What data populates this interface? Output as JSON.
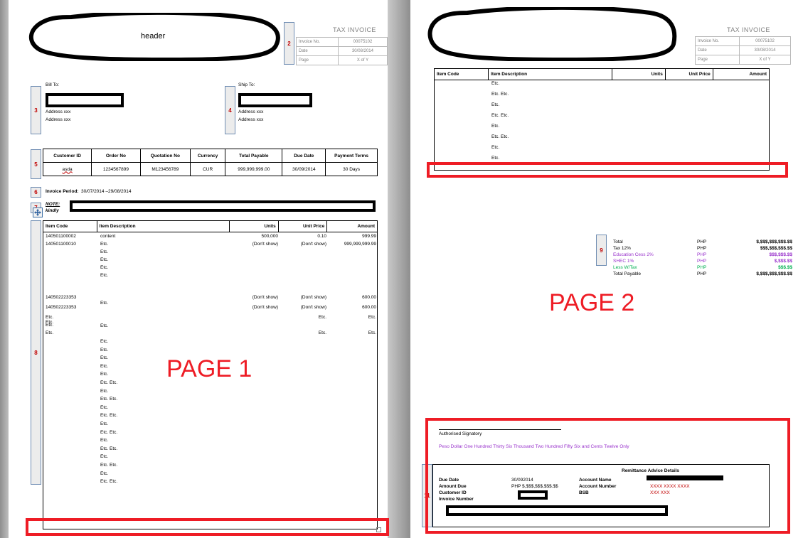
{
  "document": {
    "tax_invoice_title": "TAX INVOICE",
    "page1_watermark": "PAGE 1",
    "page2_watermark": "PAGE 2",
    "header_placeholder": "header"
  },
  "markers": [
    {
      "id": "2",
      "label": "2"
    },
    {
      "id": "3",
      "label": "3"
    },
    {
      "id": "4",
      "label": "4"
    },
    {
      "id": "5",
      "label": "5"
    },
    {
      "id": "6",
      "label": "6"
    },
    {
      "id": "7",
      "label": "7"
    },
    {
      "id": "8",
      "label": "8"
    },
    {
      "id": "9",
      "label": "9"
    },
    {
      "id": "11",
      "label": "11"
    }
  ],
  "invoice_meta": {
    "rows": [
      {
        "key": "Invoice No.",
        "value": "00075102"
      },
      {
        "key": "Date",
        "value": "30/08/2014"
      },
      {
        "key": "Page",
        "value": "X of Y"
      }
    ]
  },
  "bill_to": {
    "label": "Bill To:",
    "address_lines": [
      "Address  xxx",
      "Address  xxx"
    ]
  },
  "ship_to": {
    "label": "Ship To:",
    "address_lines": [
      "Address  xxx",
      "Address  xxx"
    ]
  },
  "customer_table": {
    "headers": [
      "Customer ID",
      "Order  No",
      "Quotation  No",
      "Currency",
      "Total Payable",
      "Due Date",
      "Payment  Terms"
    ],
    "row": [
      "asda",
      "1234567899",
      "M123456789",
      "CUR",
      "999,999,999.00",
      "30/09/2014",
      "30  Days"
    ]
  },
  "invoice_period": {
    "label": "Invoice  Period:",
    "value": "30/07/2014   –29/08/2014"
  },
  "note": {
    "label": "NOTE:",
    "second_line": "kindly"
  },
  "items_table": {
    "headers": [
      "Item Code",
      "Item Description",
      "Units",
      "Unit Price",
      "Amount"
    ],
    "page1_rows": [
      {
        "code": "140501100002",
        "desc": "content",
        "units": "500,000",
        "price": "0.10",
        "amount": "999.99"
      },
      {
        "code": "140501100010",
        "desc": "Etc.",
        "units": "(Don't show)",
        "price": "(Don't show)",
        "amount": "999,999,999.99"
      },
      {
        "code": "",
        "desc": "Etc.",
        "units": "",
        "price": "",
        "amount": ""
      },
      {
        "code": "",
        "desc": "Etc.",
        "units": "",
        "price": "",
        "amount": ""
      },
      {
        "code": "",
        "desc": "Etc.",
        "units": "",
        "price": "",
        "amount": ""
      },
      {
        "code": "",
        "desc": "Etc.",
        "units": "",
        "price": "",
        "amount": ""
      },
      {
        "code": "140502223353",
        "desc": "",
        "units": "(Don't show)",
        "price": "(Don't show)",
        "amount": "600.00"
      },
      {
        "code": "140502223353",
        "desc": "Etc.",
        "units": "(Don't show)",
        "price": "(Don't show)",
        "amount": "600.00"
      },
      {
        "code": "Etc.",
        "desc": "",
        "units": "",
        "price": "Etc.",
        "amount": "Etc."
      },
      {
        "code": "Etc.",
        "desc": "Etc.",
        "units": "",
        "price": "",
        "amount": ""
      },
      {
        "code": "Etc.",
        "desc": "",
        "units": "",
        "price": "Etc.",
        "amount": "Etc."
      },
      {
        "code": "Etc.",
        "desc": "Etc.",
        "units": "",
        "price": "",
        "amount": ""
      },
      {
        "code": "",
        "desc": "Etc.",
        "units": "",
        "price": "",
        "amount": ""
      },
      {
        "code": "",
        "desc": "Etc.",
        "units": "",
        "price": "",
        "amount": ""
      },
      {
        "code": "",
        "desc": "Etc.",
        "units": "",
        "price": "",
        "amount": ""
      },
      {
        "code": "",
        "desc": "Etc.",
        "units": "",
        "price": "",
        "amount": ""
      },
      {
        "code": "",
        "desc": "Etc.  Etc.",
        "units": "",
        "price": "",
        "amount": ""
      },
      {
        "code": "",
        "desc": "Etc.",
        "units": "",
        "price": "",
        "amount": ""
      },
      {
        "code": "",
        "desc": "Etc.  Etc.",
        "units": "",
        "price": "",
        "amount": ""
      },
      {
        "code": "",
        "desc": "Etc.",
        "units": "",
        "price": "",
        "amount": ""
      },
      {
        "code": "",
        "desc": "Etc.  Etc.",
        "units": "",
        "price": "",
        "amount": ""
      },
      {
        "code": "",
        "desc": "Etc.",
        "units": "",
        "price": "",
        "amount": ""
      },
      {
        "code": "",
        "desc": "Etc.  Etc.",
        "units": "",
        "price": "",
        "amount": ""
      },
      {
        "code": "",
        "desc": "Etc.",
        "units": "",
        "price": "",
        "amount": ""
      },
      {
        "code": "",
        "desc": "Etc.  Etc.",
        "units": "",
        "price": "",
        "amount": ""
      },
      {
        "code": "",
        "desc": "Etc.",
        "units": "",
        "price": "",
        "amount": ""
      },
      {
        "code": "",
        "desc": "Etc.  Etc.",
        "units": "",
        "price": "",
        "amount": ""
      },
      {
        "code": "",
        "desc": "Etc.",
        "units": "",
        "price": "",
        "amount": ""
      },
      {
        "code": "",
        "desc": "Etc.  Etc.",
        "units": "",
        "price": "",
        "amount": ""
      }
    ],
    "page2_rows": [
      {
        "desc": "Etc."
      },
      {
        "desc": "Etc.  Etc."
      },
      {
        "desc": "Etc."
      },
      {
        "desc": "Etc.  Etc."
      },
      {
        "desc": "Etc."
      },
      {
        "desc": "Etc.  Etc."
      },
      {
        "desc": "Etc."
      },
      {
        "desc": "Etc."
      }
    ]
  },
  "totals": {
    "rows": [
      {
        "label": "Total",
        "currency": "PHP",
        "amount": "$,$$$,$$$,$$$.$$",
        "color": "#000000"
      },
      {
        "label": "Tax 12%",
        "currency": "PHP",
        "amount": "$$$,$$$,$$$.$$",
        "color": "#000000"
      },
      {
        "label": "Education   Cess 2%",
        "currency": "PHP",
        "amount": "$$$,$$$.$$",
        "color": "#9933cc"
      },
      {
        "label": "SHEC 1%",
        "currency": "PHP",
        "amount": "$,$$$.$$",
        "color": "#9933cc"
      },
      {
        "label": "Less  W/Tax",
        "currency": "PHP",
        "amount": "$$$.$$",
        "color": "#00b050"
      },
      {
        "label": "Total  Payable",
        "currency": "PHP",
        "amount": "$,$$$,$$$,$$$.$$",
        "color": "#000000"
      }
    ]
  },
  "signature": {
    "caption": "Authorised  Signatory",
    "amount_in_words": "Peso Dollar One Hundred Thirty Six Thousand Two Hundred Fifty Six and Cents Twelve Only",
    "amount_in_words_color": "#9933cc"
  },
  "remittance": {
    "title": "Remittance  Advice  Details",
    "left_rows": [
      {
        "label": "Due Date",
        "value": "30/092014"
      },
      {
        "label": "Amount Due",
        "value": "PHP $,$$$,$$$,$$$.$$"
      },
      {
        "label": "Customer ID",
        "value": ""
      },
      {
        "label": "Invoice Number",
        "value": ""
      }
    ],
    "right_rows": [
      {
        "label": "Account Name",
        "value": ""
      },
      {
        "label": "Account Number",
        "value": "XXXX XXXX XXXX"
      },
      {
        "label": "BSB",
        "value": "XXX XXX"
      }
    ]
  },
  "colors": {
    "highlight_red": "#ee1c25",
    "marker_number": "#c00000",
    "marker_border": "#6f8db3",
    "marker_fill": "#ececec",
    "gray_text": "#808080",
    "canvas": "#9a9a9a"
  }
}
